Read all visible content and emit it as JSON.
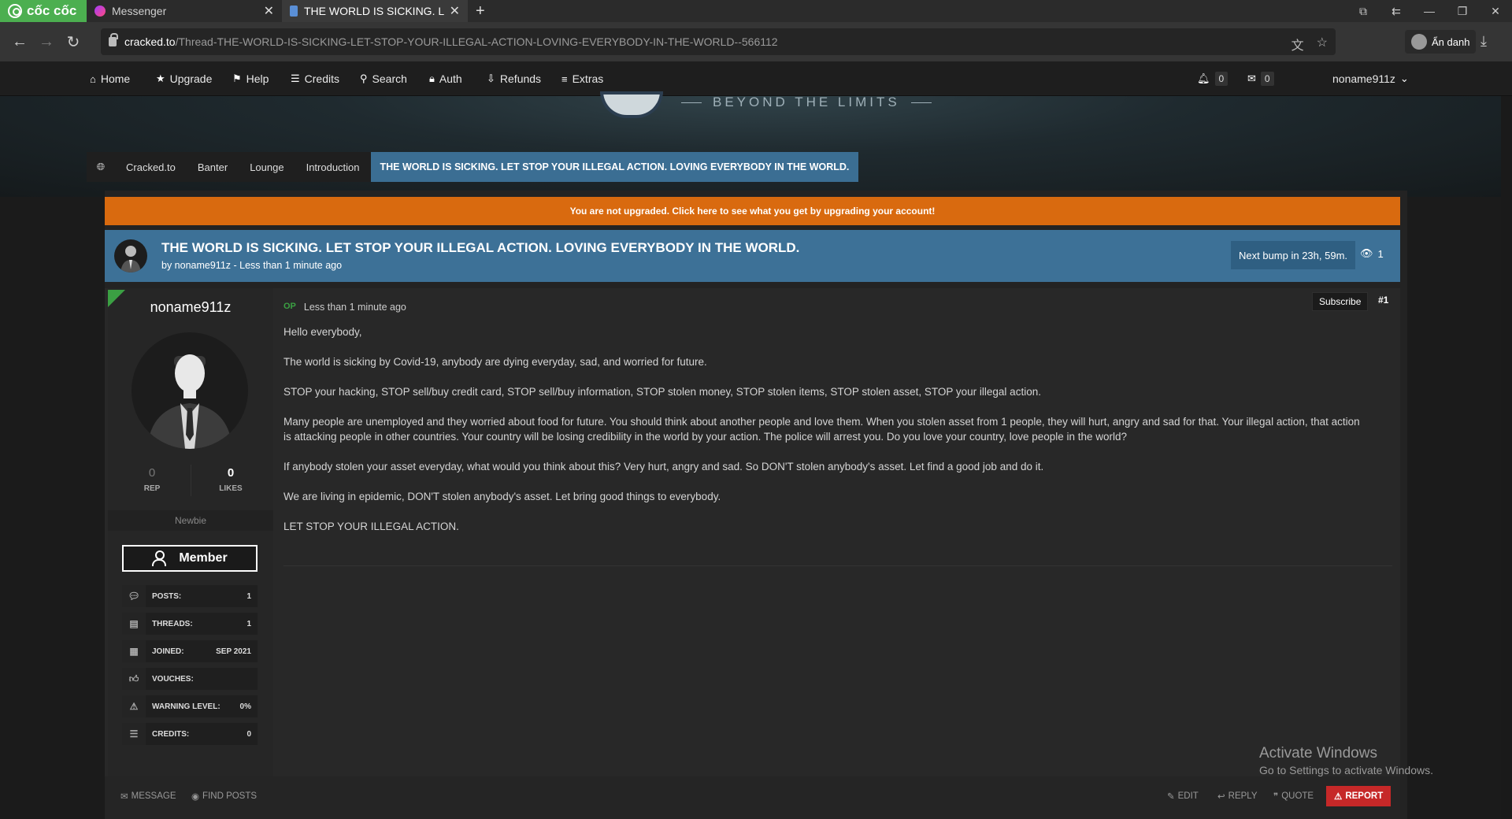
{
  "browser": {
    "brand": "cốc cốc",
    "tabs": [
      {
        "title": "Messenger",
        "close": "✕"
      },
      {
        "title": "THE WORLD IS SICKING. LET",
        "close": "✕"
      }
    ],
    "new_tab": "+",
    "url_domain": "cracked.to",
    "url_path": "/Thread-THE-WORLD-IS-SICKING-LET-STOP-YOUR-ILLEGAL-ACTION-LOVING-EVERYBODY-IN-THE-WORLD--566112",
    "profile_label": "Ẩn danh"
  },
  "nav": {
    "items": [
      "Home",
      "Upgrade",
      "Help",
      "Credits",
      "Search",
      "Auth",
      "Refunds",
      "Extras"
    ],
    "notif_count": "0",
    "inbox_count": "0",
    "username": "noname911z"
  },
  "banner": {
    "tagline": "BEYOND THE LIMITS"
  },
  "breadcrumb": [
    "Cracked.to",
    "Banter",
    "Lounge",
    "Introduction",
    "THE WORLD IS SICKING. LET STOP YOUR ILLEGAL ACTION. LOVING EVERYBODY IN THE WORLD."
  ],
  "upgrade_notice": "You are not upgraded. Click here to see what you get by upgrading your account!",
  "thread": {
    "title": "THE WORLD IS SICKING. LET STOP YOUR ILLEGAL ACTION. LOVING EVERYBODY IN THE WORLD.",
    "byline": "by noname911z - Less than 1 minute ago",
    "bump": "Next bump in 23h, 59m.",
    "views": "1"
  },
  "author": {
    "name": "noname911z",
    "rep": "0",
    "rep_label": "REP",
    "likes": "0",
    "likes_label": "LIKES",
    "rank": "Newbie",
    "usergroup": "Member",
    "stats": [
      {
        "label": "POSTS:",
        "value": "1"
      },
      {
        "label": "THREADS:",
        "value": "1"
      },
      {
        "label": "JOINED:",
        "value": "SEP 2021"
      },
      {
        "label": "VOUCHES:",
        "value": ""
      },
      {
        "label": "WARNING LEVEL:",
        "value": "0%"
      },
      {
        "label": "CREDITS:",
        "value": "0"
      }
    ]
  },
  "post": {
    "op_label": "OP",
    "time": "Less than 1 minute ago",
    "subscribe": "Subscribe",
    "number": "#1",
    "paragraphs": [
      "Hello everybody,",
      "The world is sicking by Covid-19, anybody are dying everyday, sad, and worried for future.",
      "STOP your hacking, STOP sell/buy credit card, STOP sell/buy information, STOP stolen money, STOP stolen items, STOP stolen asset, STOP your illegal action.",
      "Many people are unemployed and they worried about food for future. You should think about another people and love them. When you stolen asset from 1 people, they will hurt, angry and sad for that. Your illegal action, that action is attacking people in other countries. Your country will be losing credibility in the world by your action. The police will arrest you. Do you love your country, love people in the world?",
      "If anybody stolen your asset everyday, what would you think about this? Very hurt, angry and sad. So DON'T stolen anybody's asset. Let find a good job and do it.",
      "We are living in epidemic, DON'T stolen anybody's asset. Let bring good things to everybody.",
      "LET STOP YOUR ILLEGAL ACTION."
    ]
  },
  "footer": {
    "message": "MESSAGE",
    "find_posts": "FIND POSTS",
    "edit": "EDIT",
    "reply": "REPLY",
    "quote": "QUOTE",
    "report": "REPORT"
  },
  "watermark": {
    "line1": "Activate Windows",
    "line2": "Go to Settings to activate Windows."
  }
}
